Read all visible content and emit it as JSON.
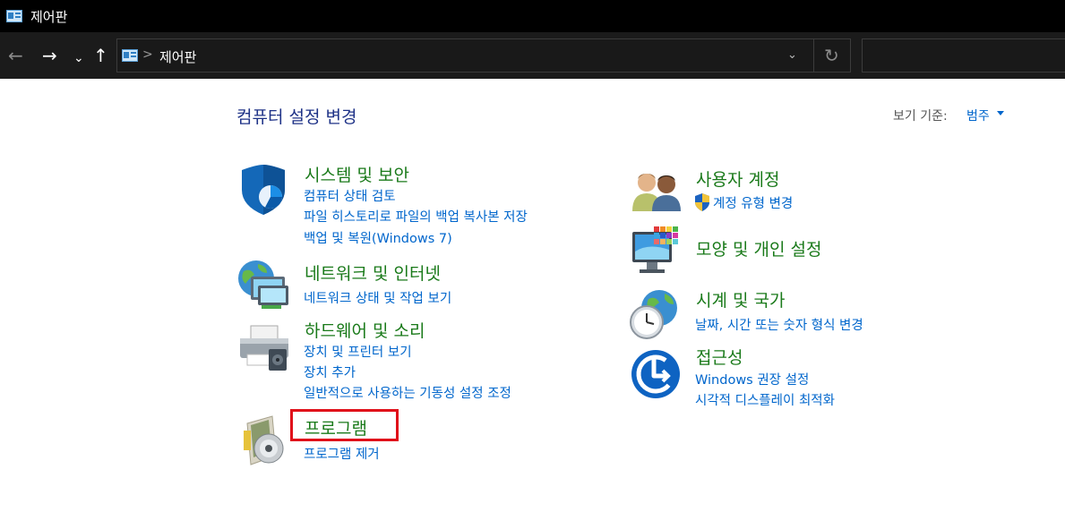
{
  "window": {
    "title": "제어판"
  },
  "address": {
    "breadcrumb": "제어판",
    "separator": ">"
  },
  "nav": {
    "back": "←",
    "forward": "→",
    "history": "⌄",
    "up": "↑",
    "dropdown": "⌄",
    "refresh": "↻"
  },
  "main": {
    "heading": "컴퓨터 설정 변경",
    "view_by_label": "보기 기준:",
    "view_by_value": "범주"
  },
  "categories": {
    "system_security": {
      "title": "시스템 및 보안",
      "links": [
        "컴퓨터 상태 검토",
        "파일 히스토리로 파일의 백업 복사본 저장",
        "백업 및 복원(Windows 7)"
      ]
    },
    "network": {
      "title": "네트워크 및 인터넷",
      "links": [
        "네트워크 상태 및 작업 보기"
      ]
    },
    "hardware": {
      "title": "하드웨어 및 소리",
      "links": [
        "장치 및 프린터 보기",
        "장치 추가",
        "일반적으로 사용하는 기동성 설정 조정"
      ]
    },
    "programs": {
      "title": "프로그램",
      "links": [
        "프로그램 제거"
      ]
    },
    "user_accounts": {
      "title": "사용자 계정",
      "links": [
        "계정 유형 변경"
      ]
    },
    "appearance": {
      "title": "모양 및 개인 설정",
      "links": []
    },
    "clock_region": {
      "title": "시계 및 국가",
      "links": [
        "날짜, 시간 또는 숫자 형식 변경"
      ]
    },
    "ease_of_access": {
      "title": "접근성",
      "links": [
        "Windows 권장 설정",
        "시각적 디스플레이 최적화"
      ]
    }
  },
  "colors": {
    "title_green": "#1a7a1a",
    "link_blue": "#0066cc",
    "heading_blue": "#1e3287",
    "highlight_red": "#e0101a",
    "chrome_dark": "#1b1b1b"
  },
  "icons": [
    "control-panel-icon",
    "shield-icon",
    "network-globe-icon",
    "printer-icon",
    "programs-disc-icon",
    "users-icon",
    "uac-shield-icon",
    "appearance-monitor-icon",
    "clock-globe-icon",
    "ease-of-access-icon"
  ]
}
